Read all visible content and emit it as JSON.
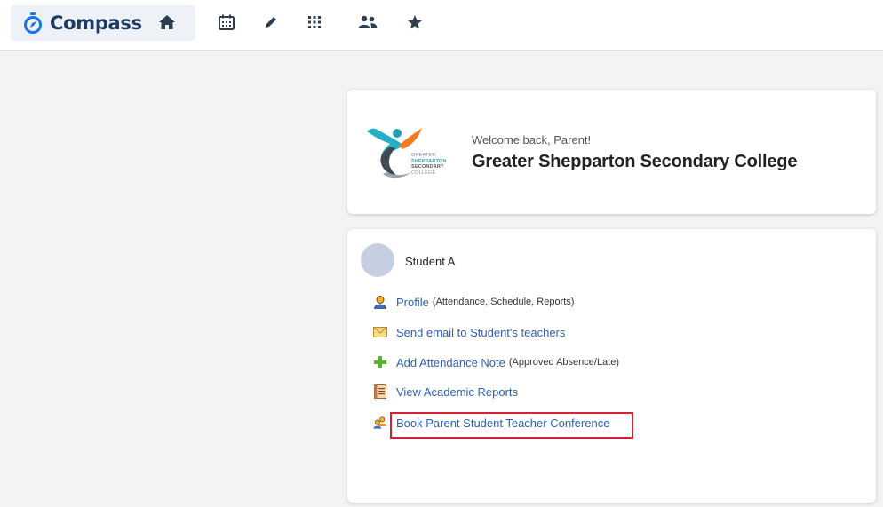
{
  "app": {
    "brand_name": "Compass",
    "brand_color": "#1f3a63",
    "accent_color": "#1a73e8"
  },
  "nav": {
    "icons": [
      "home-icon",
      "calendar-icon",
      "pencil-icon",
      "apps-grid-icon",
      "people-icon",
      "star-icon"
    ]
  },
  "welcome": {
    "greeting": "Welcome back, Parent!",
    "school_name": "Greater Shepparton Secondary College",
    "logo_lines": [
      "GREATER",
      "SHEPPARTON",
      "SECONDARY",
      "COLLEGE"
    ]
  },
  "student": {
    "name": "Student A",
    "links": {
      "profile": {
        "label": "Profile",
        "note": "(Attendance, Schedule, Reports)",
        "icon": "person-icon"
      },
      "email": {
        "label": "Send email to Student's teachers",
        "icon": "envelope-icon"
      },
      "attendance": {
        "label": "Add Attendance Note",
        "note": "(Approved Absence/Late)",
        "icon": "plus-icon"
      },
      "reports": {
        "label": "View Academic Reports",
        "icon": "report-book-icon"
      },
      "conference": {
        "label": "Book Parent Student Teacher Conference",
        "icon": "conference-people-icon",
        "highlight_color": "#d8202f"
      }
    }
  }
}
